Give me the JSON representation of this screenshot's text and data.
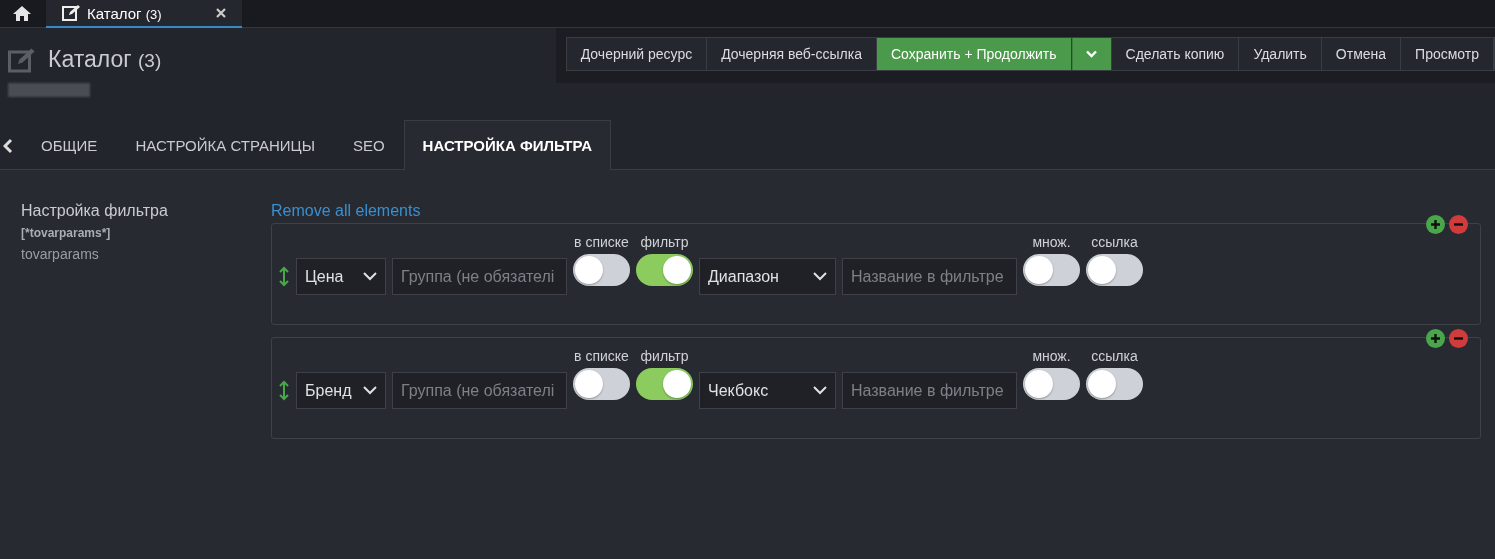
{
  "top_tabs": [
    {
      "kind": "home",
      "selected": false
    },
    {
      "kind": "doc",
      "label": "Каталог",
      "count": "(3)",
      "selected": true
    }
  ],
  "header": {
    "title": "Каталог",
    "count": "(3)"
  },
  "actions": [
    {
      "label": "Дочерний ресурс",
      "kind": "plain"
    },
    {
      "label": "Дочерняя веб-ссылка",
      "kind": "plain"
    },
    {
      "label": "Сохранить + Продолжить",
      "kind": "primary"
    },
    {
      "label": "Сделать копию",
      "kind": "plain"
    },
    {
      "label": "Удалить",
      "kind": "plain"
    },
    {
      "label": "Отмена",
      "kind": "plain"
    },
    {
      "label": "Просмотр",
      "kind": "plain"
    }
  ],
  "tabs": [
    {
      "label": "ОБЩИЕ",
      "selected": false
    },
    {
      "label": "НАСТРОЙКА СТРАНИЦЫ",
      "selected": false
    },
    {
      "label": "SEO",
      "selected": false
    },
    {
      "label": "НАСТРОЙКА ФИЛЬТРА",
      "selected": true
    }
  ],
  "field": {
    "label": "Настройка фильтра",
    "tag": "[*tovarparams*]",
    "name": "tovarparams"
  },
  "remove_all": "Remove all elements",
  "rows": [
    {
      "param": "Цена",
      "group_placeholder": "Группа (не обязателі",
      "in_list_label": "в списке",
      "in_list": false,
      "filter_label": "фильтр",
      "filter": true,
      "type": "Диапазон",
      "name_placeholder": "Название в фильтре",
      "multi_label": "множ.",
      "multi": false,
      "link_label": "ссылка",
      "link": false
    },
    {
      "param": "Бренд",
      "group_placeholder": "Группа (не обязателі",
      "in_list_label": "в списке",
      "in_list": false,
      "filter_label": "фильтр",
      "filter": true,
      "type": "Чекбокс",
      "name_placeholder": "Название в фильтре",
      "multi_label": "множ.",
      "multi": false,
      "link_label": "ссылка",
      "link": false
    }
  ]
}
